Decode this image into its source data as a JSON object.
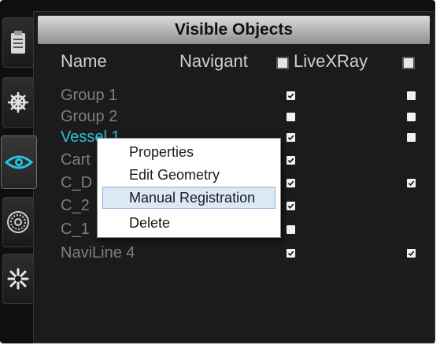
{
  "panel": {
    "title": "Visible Objects",
    "columns": {
      "name": "Name",
      "navigant": "Navigant",
      "livexray": "LiveXRay"
    }
  },
  "sidebar": {
    "tabs": [
      {
        "icon": "clipboard-icon",
        "active": false
      },
      {
        "icon": "ship-wheel-icon",
        "active": false
      },
      {
        "icon": "eye-icon",
        "active": true
      },
      {
        "icon": "target-icon",
        "active": false
      },
      {
        "icon": "burst-icon",
        "active": false
      }
    ]
  },
  "rows": [
    {
      "name": "Group 1",
      "navigant": true,
      "livexray": false
    },
    {
      "name": "Group 2",
      "navigant": false,
      "livexray": false
    },
    {
      "name": "Vessel 1",
      "navigant": true,
      "livexray": false,
      "selected": true
    },
    {
      "name": "Cart",
      "navigant": true,
      "livexray": null
    },
    {
      "name": "C_D",
      "navigant": true,
      "livexray": true
    },
    {
      "name": "C_2",
      "navigant": true,
      "livexray": null
    },
    {
      "name": "C_1",
      "navigant": false,
      "livexray": null
    },
    {
      "name": "NaviLine 4",
      "navigant": true,
      "livexray": true
    }
  ],
  "context_menu": {
    "items": [
      "Properties",
      "Edit Geometry",
      "Manual Registration",
      "Delete"
    ],
    "highlighted": "Manual Registration"
  },
  "colors": {
    "selected_text": "#2ec0d9",
    "menu_highlight": "#dbe8f6"
  }
}
